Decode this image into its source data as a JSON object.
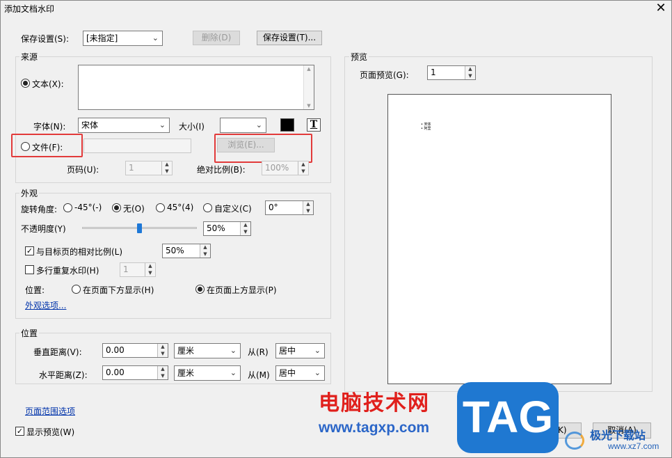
{
  "window": {
    "title": "添加文档水印",
    "close_glyph": "✕"
  },
  "save_settings": {
    "label": "保存设置(S):",
    "value": "[未指定]",
    "delete_label": "删除(D)",
    "save_button_label": "保存设置(T)..."
  },
  "source": {
    "legend": "来源",
    "text_radio_label": "文本(X):",
    "font_label": "字体(N):",
    "font_value": "宋体",
    "size_label": "大小(I)",
    "size_value": "",
    "color_value": "#000000",
    "text_format_glyph": "T",
    "file_radio_label": "文件(F):",
    "browse_label": "浏览(E)...",
    "page_label": "页码(U):",
    "page_value": "1",
    "scale_label": "绝对比例(B):",
    "scale_value": "100%"
  },
  "appearance": {
    "legend": "外观",
    "rotation_label": "旋转角度:",
    "rot_neg45": "-45°(-)",
    "rot_none": "无(O)",
    "rot_45": "45°(4)",
    "rot_custom": "自定义(C)",
    "rot_custom_value": "0°",
    "opacity_label": "不透明度(Y)",
    "opacity_value": "50%",
    "opacity_level": 0.5,
    "relative_scale_label": "与目标页的相对比例(L)",
    "relative_scale_value": "50%",
    "multiline_label": "多行重复水印(H)",
    "multiline_value": "1",
    "position_label": "位置:",
    "pos_below": "在页面下方显示(H)",
    "pos_above": "在页面上方显示(P)",
    "options_link": "外观选项..."
  },
  "position": {
    "legend": "位置",
    "vertical_label": "垂直距离(V):",
    "vertical_value": "0.00",
    "vertical_unit": "厘米",
    "vertical_from_label": "从(R)",
    "vertical_from_value": "居中",
    "horizontal_label": "水平距离(Z):",
    "horizontal_value": "0.00",
    "horizontal_unit": "厘米",
    "horizontal_from_label": "从(M)",
    "horizontal_from_value": "居中"
  },
  "preview": {
    "legend": "预览",
    "page_label": "页面预览(G):",
    "page_value": "1",
    "bullets": [
      "宋体",
      "阿里"
    ]
  },
  "footer": {
    "page_range_link": "页面范围选项",
    "show_preview_label": "显示预览(W)",
    "ok_label": "确定(K)",
    "cancel_label": "取消(A)"
  },
  "watermark": {
    "site_cn": "电脑技术网",
    "site_url": "www.tagxp.com",
    "tag_logo": "TAG",
    "corner_site": "极光下载站",
    "corner_url": "www.xz7.com"
  }
}
